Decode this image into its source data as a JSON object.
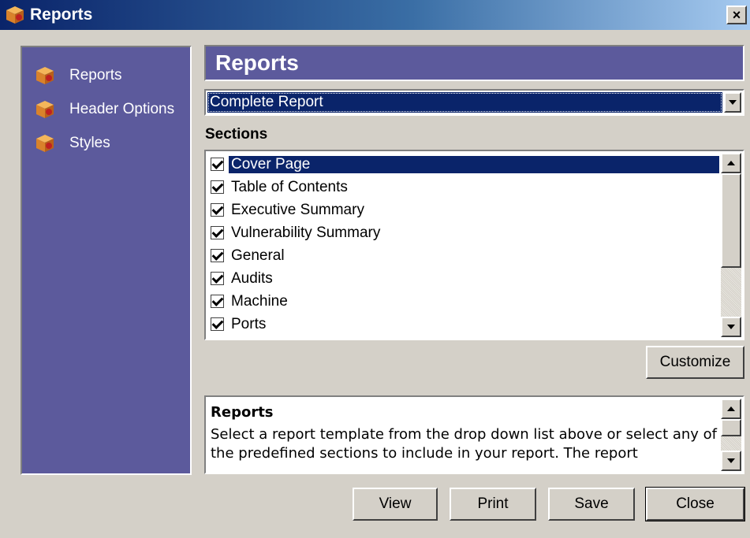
{
  "window": {
    "title": "Reports",
    "close_glyph": "×"
  },
  "sidebar": {
    "items": [
      {
        "label": "Reports",
        "icon": "package-icon"
      },
      {
        "label": "Header Options",
        "icon": "package-icon"
      },
      {
        "label": "Styles",
        "icon": "package-icon"
      }
    ]
  },
  "panel": {
    "title": "Reports",
    "template_select": {
      "value": "Complete Report"
    },
    "sections_label": "Sections",
    "sections": [
      {
        "label": "Cover Page",
        "checked": true,
        "selected": true
      },
      {
        "label": "Table of Contents",
        "checked": true
      },
      {
        "label": "Executive Summary",
        "checked": true
      },
      {
        "label": "Vulnerability Summary",
        "checked": true
      },
      {
        "label": "General",
        "checked": true
      },
      {
        "label": "Audits",
        "checked": true
      },
      {
        "label": "Machine",
        "checked": true
      },
      {
        "label": "Ports",
        "checked": true
      }
    ],
    "customize_label": "Customize",
    "description": {
      "title": "Reports",
      "text": "Select a report template from the drop down list above or select any of the predefined sections to include in your report. The report"
    }
  },
  "buttons": {
    "view": "View",
    "print": "Print",
    "save": "Save",
    "close": "Close"
  },
  "colors": {
    "title_gradient_start": "#0a246a",
    "panel_purple": "#5c5a9c",
    "selection": "#0a246a",
    "face": "#d4d0c8"
  }
}
